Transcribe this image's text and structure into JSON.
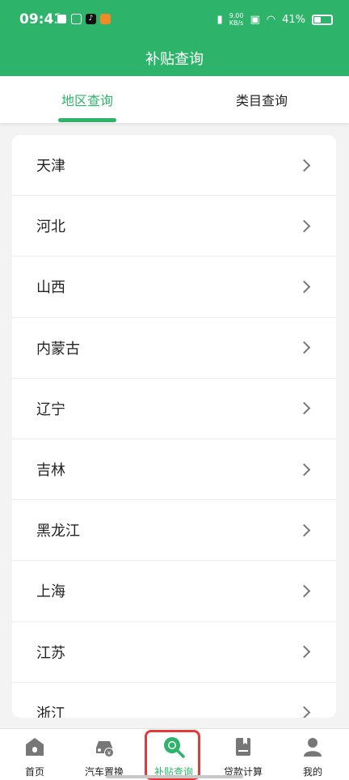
{
  "status_bar": {
    "time": "09:41",
    "net_speed_value": "9.00",
    "net_speed_unit": "KB/s",
    "battery": "41%"
  },
  "header": {
    "title": "补贴查询"
  },
  "tabs": [
    {
      "label": "地区查询",
      "active": true
    },
    {
      "label": "类目查询",
      "active": false
    }
  ],
  "regions": [
    "天津",
    "河北",
    "山西",
    "内蒙古",
    "辽宁",
    "吉林",
    "黑龙江",
    "上海",
    "江苏",
    "浙江"
  ],
  "bottom_nav": [
    {
      "label": "首页",
      "icon": "home-icon",
      "active": false
    },
    {
      "label": "汽车置换",
      "icon": "car-exchange-icon",
      "active": false
    },
    {
      "label": "补贴查询",
      "icon": "search-icon",
      "active": true
    },
    {
      "label": "贷款计算",
      "icon": "book-icon",
      "active": false
    },
    {
      "label": "我的",
      "icon": "user-icon",
      "active": false
    }
  ],
  "colors": {
    "primary": "#2db46a",
    "highlight": "#e53935"
  }
}
